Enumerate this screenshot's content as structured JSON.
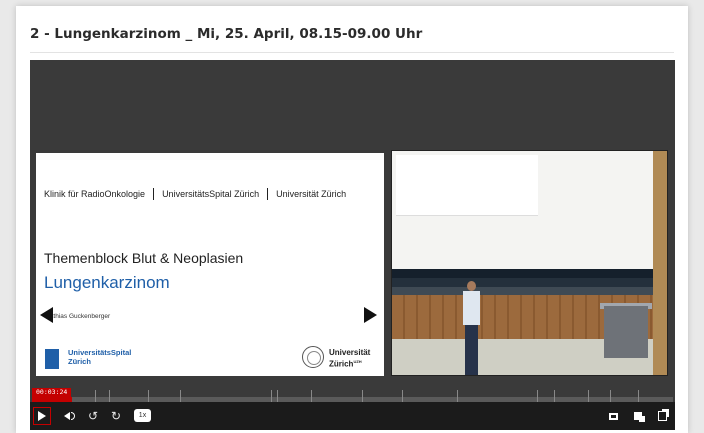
{
  "page": {
    "title": "2 - Lungenkarzinom _ Mi, 25. April, 08.15-09.00 Uhr"
  },
  "slide": {
    "header_items": [
      "Klinik für RadioOnkologie",
      "UniversitätsSpital Zürich",
      "Universität Zürich"
    ],
    "subtitle": "Themenblock Blut & Neoplasien",
    "title": "Lungenkarzinom",
    "author": "atthias Guckenberger",
    "usz_logo_line1": "UniversitätsSpital",
    "usz_logo_line2": "Zürich",
    "uzh_logo_line1": "Universität",
    "uzh_logo_line2": "Zürich",
    "uzh_logo_sup": "UZH",
    "title_color": "#1f5fa8"
  },
  "player": {
    "current_time": "00:03:24",
    "progress": 0.062,
    "speed": "1x",
    "accent_color": "#c40000",
    "icons": [
      "play-icon",
      "volume-icon",
      "rewind-icon",
      "forward-icon",
      "fullscreen-icon",
      "layout-icon",
      "copy-icon"
    ]
  }
}
